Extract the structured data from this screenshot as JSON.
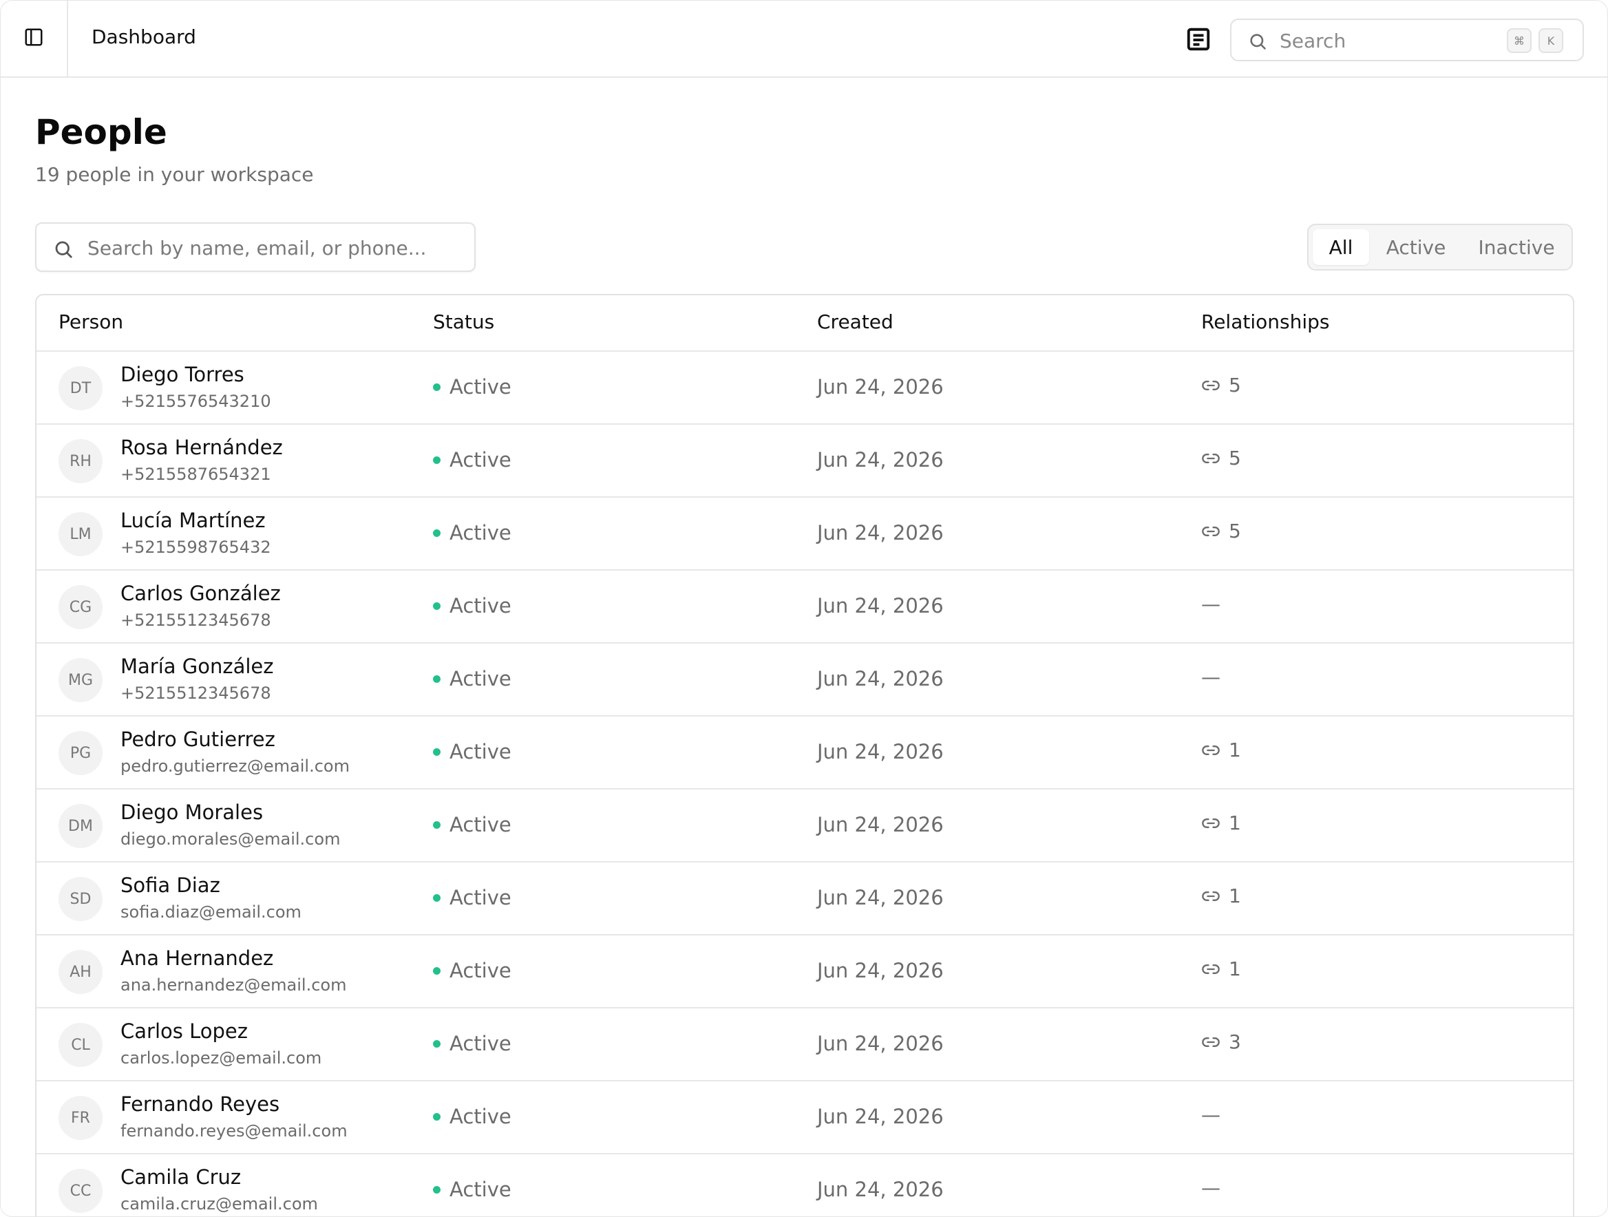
{
  "header": {
    "breadcrumb": "Dashboard",
    "search_placeholder": "Search",
    "shortcut_keys": [
      "⌘",
      "K"
    ],
    "icons": [
      "sidebar-toggle-icon",
      "docs-icon",
      "search-icon"
    ]
  },
  "page": {
    "title": "People",
    "subtitle": "19 people in your workspace",
    "search_placeholder": "Search by name, email, or phone...",
    "filters": [
      "All",
      "Active",
      "Inactive"
    ],
    "selected_filter": "All"
  },
  "table": {
    "columns": [
      "Person",
      "Status",
      "Created",
      "Relationships"
    ],
    "rows": [
      {
        "initials": "DT",
        "name": "Diego Torres",
        "contact": "+5215576543210",
        "status": "Active",
        "created": "Jun 24, 2026",
        "relationships": "5"
      },
      {
        "initials": "RH",
        "name": "Rosa Hernández",
        "contact": "+5215587654321",
        "status": "Active",
        "created": "Jun 24, 2026",
        "relationships": "5"
      },
      {
        "initials": "LM",
        "name": "Lucía Martínez",
        "contact": "+5215598765432",
        "status": "Active",
        "created": "Jun 24, 2026",
        "relationships": "5"
      },
      {
        "initials": "CG",
        "name": "Carlos González",
        "contact": "+5215512345678",
        "status": "Active",
        "created": "Jun 24, 2026",
        "relationships": "—"
      },
      {
        "initials": "MG",
        "name": "María González",
        "contact": "+5215512345678",
        "status": "Active",
        "created": "Jun 24, 2026",
        "relationships": "—"
      },
      {
        "initials": "PG",
        "name": "Pedro Gutierrez",
        "contact": "pedro.gutierrez@email.com",
        "status": "Active",
        "created": "Jun 24, 2026",
        "relationships": "1"
      },
      {
        "initials": "DM",
        "name": "Diego Morales",
        "contact": "diego.morales@email.com",
        "status": "Active",
        "created": "Jun 24, 2026",
        "relationships": "1"
      },
      {
        "initials": "SD",
        "name": "Sofia Diaz",
        "contact": "sofia.diaz@email.com",
        "status": "Active",
        "created": "Jun 24, 2026",
        "relationships": "1"
      },
      {
        "initials": "AH",
        "name": "Ana Hernandez",
        "contact": "ana.hernandez@email.com",
        "status": "Active",
        "created": "Jun 24, 2026",
        "relationships": "1"
      },
      {
        "initials": "CL",
        "name": "Carlos Lopez",
        "contact": "carlos.lopez@email.com",
        "status": "Active",
        "created": "Jun 24, 2026",
        "relationships": "3"
      },
      {
        "initials": "FR",
        "name": "Fernando Reyes",
        "contact": "fernando.reyes@email.com",
        "status": "Active",
        "created": "Jun 24, 2026",
        "relationships": "—"
      },
      {
        "initials": "CC",
        "name": "Camila Cruz",
        "contact": "camila.cruz@email.com",
        "status": "Active",
        "created": "Jun 24, 2026",
        "relationships": "—"
      }
    ]
  },
  "colors": {
    "status_active": "#22c08a",
    "border": "#e5e5e5",
    "muted_text": "#6b6b6b"
  }
}
